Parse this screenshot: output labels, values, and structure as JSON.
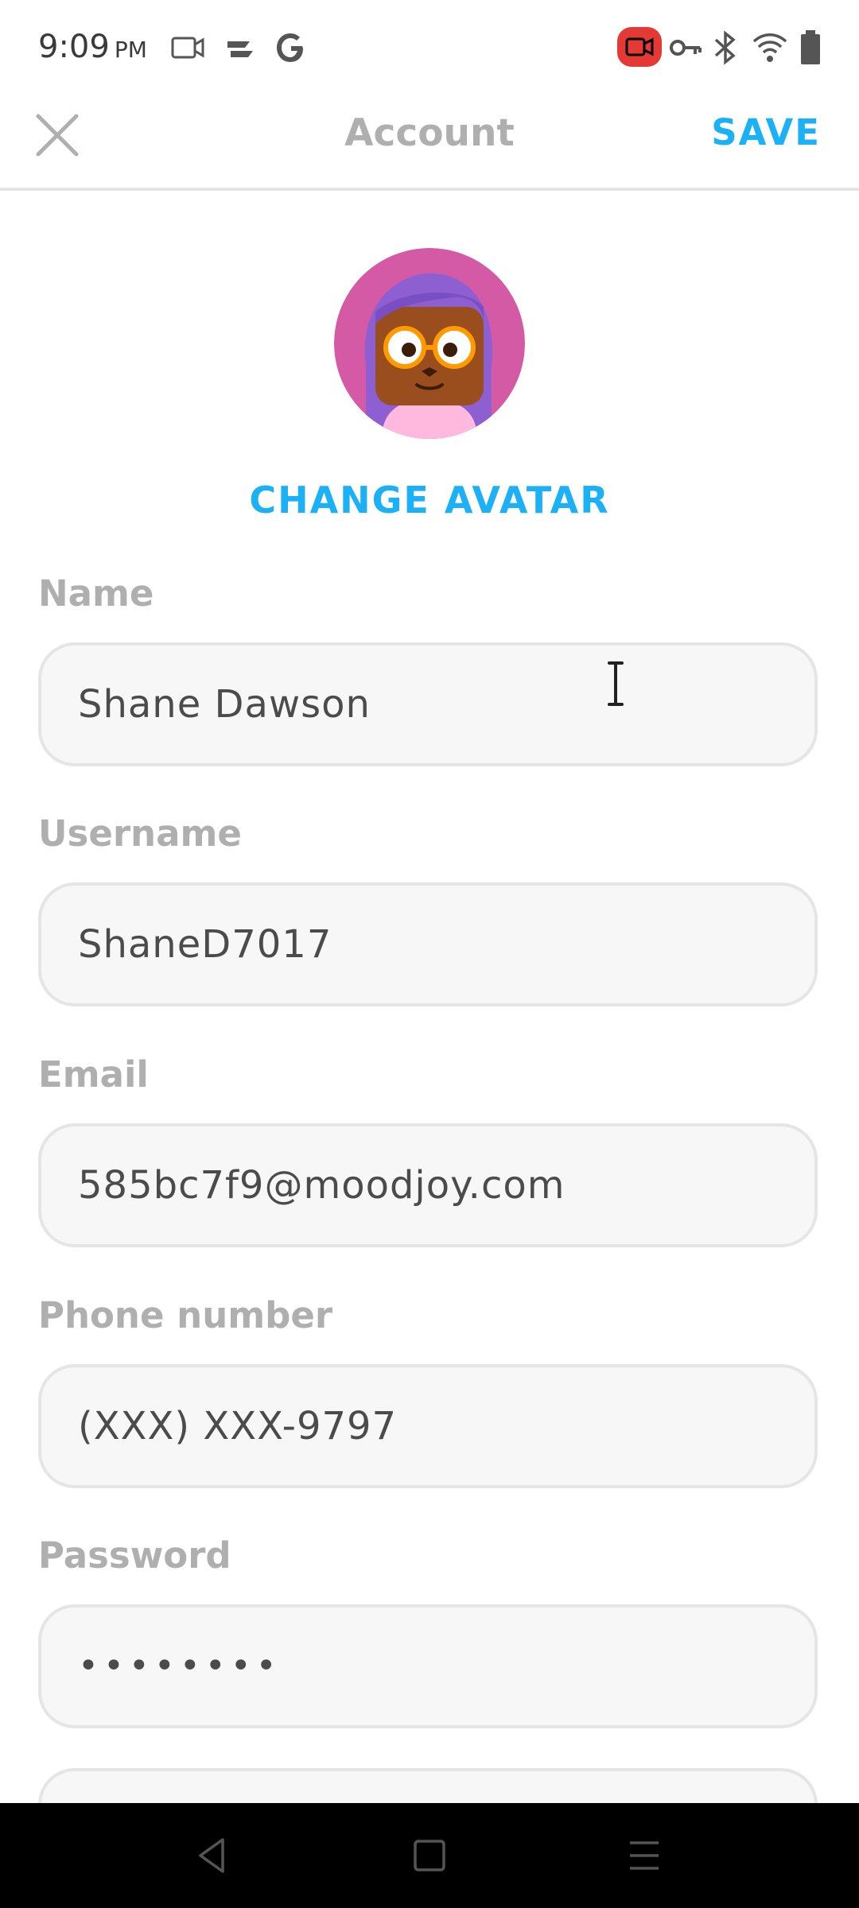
{
  "status_bar": {
    "time": "9:09",
    "ampm": "PM",
    "icons": [
      "video-icon",
      "app-icon",
      "google-icon",
      "screen-record-icon",
      "vpn-key-icon",
      "bluetooth-icon",
      "wifi-icon",
      "battery-icon"
    ]
  },
  "header": {
    "title": "Account",
    "save_label": "SAVE",
    "close_icon": "close-icon"
  },
  "avatar": {
    "change_label": "CHANGE AVATAR"
  },
  "fields": [
    {
      "label": "Name",
      "value": "Shane Dawson"
    },
    {
      "label": "Username",
      "value": "ShaneD7017"
    },
    {
      "label": "Email",
      "value": "585bc7f9@moodjoy.com"
    },
    {
      "label": "Phone number",
      "value": "(XXX) XXX-9797"
    },
    {
      "label": "Password",
      "value": "••••••••"
    }
  ],
  "nav": {
    "icons": [
      "back-icon",
      "home-icon",
      "recents-icon"
    ]
  },
  "colors": {
    "accent": "#1cb0f6",
    "label_gray": "#afafaf",
    "field_bg": "#f7f7f7",
    "field_border": "#e5e5e5",
    "text": "#4b4b4b",
    "record_red": "#e53935"
  }
}
